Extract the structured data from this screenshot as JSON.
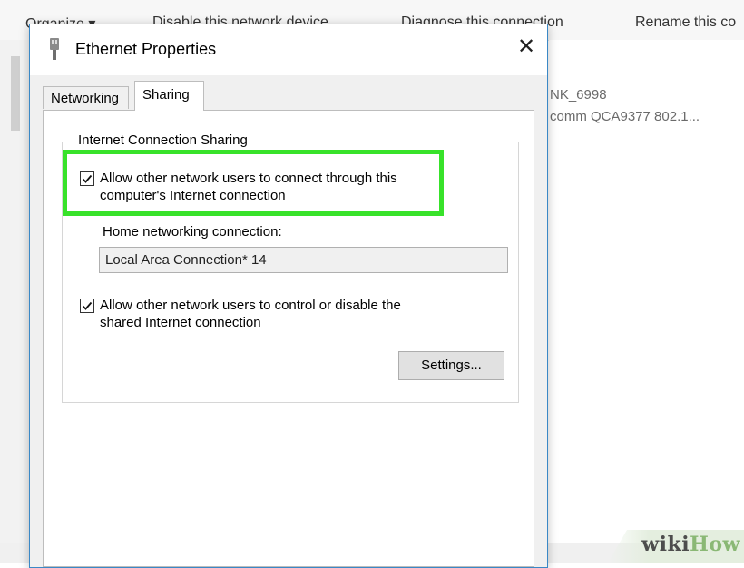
{
  "explorer": {
    "toolbar": {
      "organize": "Organize ▾",
      "disable": "Disable this network device",
      "diagnose": "Diagnose this connection",
      "rename": "Rename this co"
    },
    "network": {
      "name": "NK_6998",
      "adapter": "comm QCA9377 802.1..."
    }
  },
  "dialog": {
    "title": "Ethernet Properties",
    "close": "✕",
    "tabs": [
      "Networking",
      "Sharing"
    ],
    "active_tab": "Sharing",
    "sharing": {
      "group_title": "Internet Connection Sharing",
      "allow_connect": {
        "line1": "Allow other network users to connect through this",
        "line2": "computer's Internet connection",
        "checked": true
      },
      "home_label": "Home networking connection:",
      "home_value": "Local Area Connection* 14",
      "allow_control": {
        "line1": "Allow other network users to control or disable the",
        "line2": "shared Internet connection",
        "checked": true
      },
      "settings_button": "Settings..."
    },
    "highlight_color": "#38e22a"
  },
  "watermark": {
    "part1": "wiki",
    "part2": "How"
  }
}
